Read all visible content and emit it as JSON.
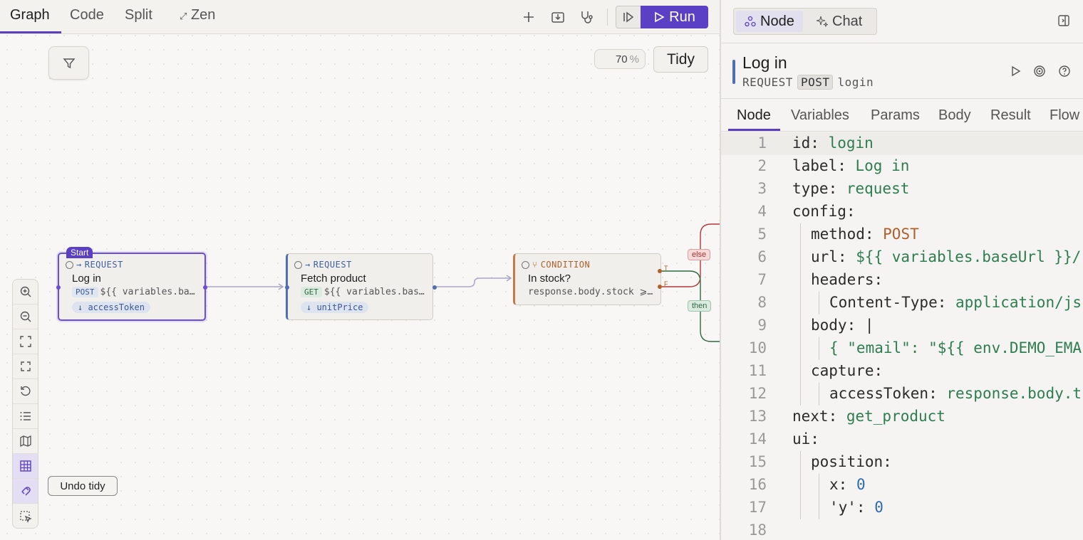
{
  "view_tabs": [
    "Graph",
    "Code",
    "Split",
    "Zen"
  ],
  "run_label": "Run",
  "zoom": {
    "value": "70",
    "unit": "%"
  },
  "tidy_label": "Tidy",
  "undo_tidy_label": "Undo tidy",
  "nodes": {
    "login": {
      "start_tag": "Start",
      "type": "REQUEST",
      "title": "Log in",
      "method": "POST",
      "url": "${{ variables.ba…",
      "capture": "↓ accessToken"
    },
    "fetch": {
      "type": "REQUEST",
      "title": "Fetch product",
      "method": "GET",
      "url": "${{ variables.bas…",
      "capture": "↓ unitPrice"
    },
    "cond": {
      "type": "CONDITION",
      "title": "In stock?",
      "expr": "response.body.stock  ⩾…",
      "port_t": "T",
      "port_f": "F"
    }
  },
  "edge_labels": {
    "else": "else",
    "then": "then"
  },
  "panel": {
    "tabs": [
      "Node",
      "Chat"
    ],
    "title": "Log in",
    "kind": "REQUEST",
    "method": "POST",
    "id": "login",
    "sub_tabs": [
      "Node",
      "Variables",
      "Params",
      "Body",
      "Result",
      "Flow"
    ]
  },
  "code_lines": [
    "1",
    "2",
    "3",
    "4",
    "5",
    "6",
    "7",
    "8",
    "9",
    "10",
    "11",
    "12",
    "13",
    "14",
    "15",
    "16",
    "17",
    "18"
  ],
  "code": {
    "l1k": "id: ",
    "l1v": "login",
    "l2k": "label: ",
    "l2v": "Log in",
    "l3k": "type: ",
    "l3v": "request",
    "l4k": "config:",
    "l5k": "method: ",
    "l5v": "POST",
    "l6k": "url: ",
    "l6v": "${{ variables.baseUrl }}/",
    "l7k": "headers:",
    "l8k": "Content-Type: ",
    "l8v": "application/js",
    "l9k": "body: |",
    "l10v": "{ \"email\": \"${{ env.DEMO_EMA",
    "l11k": "capture:",
    "l12k": "accessToken: ",
    "l12v": "response.body.t",
    "l13k": "next: ",
    "l13v": "get_product",
    "l14k": "ui:",
    "l15k": "position:",
    "l16k": "x: ",
    "l16v": "0",
    "l17k": "'y': ",
    "l17v": "0"
  },
  "colors": {
    "accent": "#5b3fc4",
    "request": "#4f6fb0",
    "condition": "#c27a4a",
    "then": "#2e6a44",
    "else": "#a33333"
  }
}
